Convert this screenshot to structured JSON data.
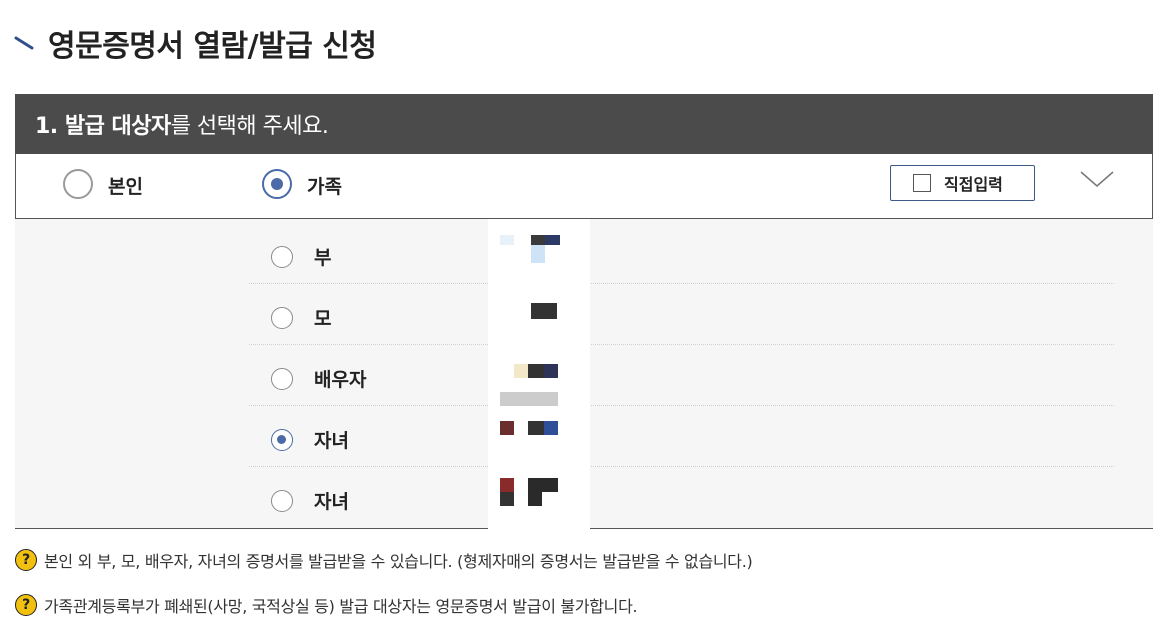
{
  "page": {
    "title": "영문증명서 열람/발급 신청"
  },
  "step1": {
    "header_bold": "1. 발급 대상자",
    "header_rest": "를 선택해 주세요.",
    "options": [
      {
        "label": "본인",
        "selected": false
      },
      {
        "label": "가족",
        "selected": true
      }
    ],
    "direct_input_label": "직접입력"
  },
  "family": {
    "members": [
      {
        "relation": "부",
        "selected": false
      },
      {
        "relation": "모",
        "selected": false
      },
      {
        "relation": "배우자",
        "selected": false
      },
      {
        "relation": "자녀",
        "selected": true
      },
      {
        "relation": "자녀",
        "selected": false
      }
    ]
  },
  "notes": [
    {
      "icon": "question-icon",
      "text": "본인 외 부, 모, 배우자, 자녀의 증명서를 발급받을 수 있습니다. (형제자매의 증명서는 발급받을 수 없습니다.)"
    },
    {
      "icon": "question-icon",
      "text": "가족관계등록부가 폐쇄된(사망, 국적상실 등) 발급 대상자는 영문증명서 발급이 불가합니다."
    }
  ],
  "colors": {
    "header_bg": "#4b4b4b",
    "accent": "#4a6aa8",
    "panel_bg": "#f6f6f6",
    "help_icon": "#f2c10f"
  }
}
